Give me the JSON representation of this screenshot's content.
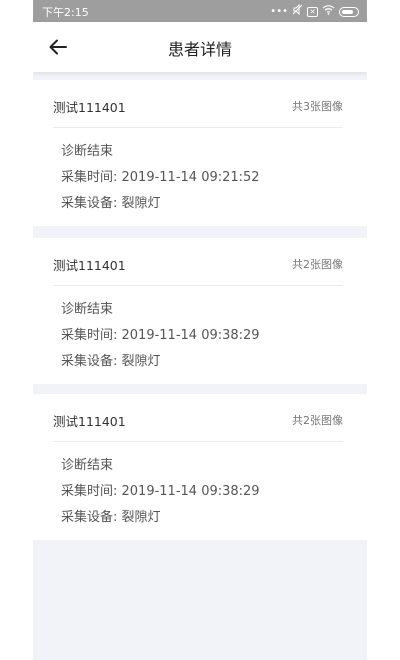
{
  "status_bar": {
    "time": "下午2:15",
    "icons": [
      "more-dots-icon",
      "mute-icon",
      "sim-icon",
      "wifi-icon",
      "battery-charging-icon"
    ]
  },
  "header": {
    "title": "患者详情"
  },
  "records": [
    {
      "name": "测试111401",
      "image_count": "共3张图像",
      "status": "诊断结束",
      "time": "采集时间: 2019-11-14 09:21:52",
      "device": "采集设备: 裂隙灯"
    },
    {
      "name": "测试111401",
      "image_count": "共2张图像",
      "status": "诊断结束",
      "time": "采集时间: 2019-11-14 09:38:29",
      "device": "采集设备: 裂隙灯"
    },
    {
      "name": "测试111401",
      "image_count": "共2张图像",
      "status": "诊断结束",
      "time": "采集时间: 2019-11-14 09:38:29",
      "device": "采集设备: 裂隙灯"
    }
  ]
}
